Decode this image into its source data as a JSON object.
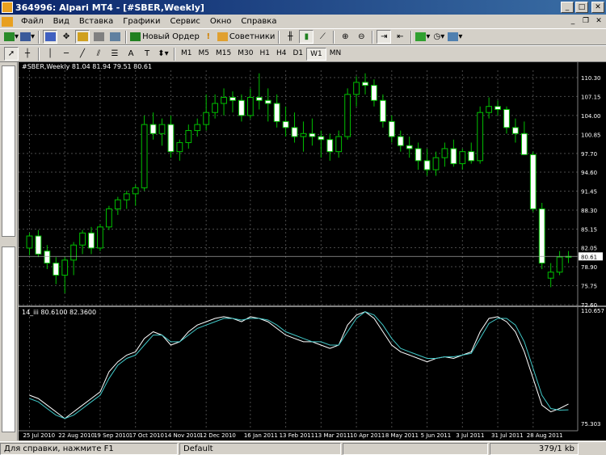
{
  "window": {
    "title": "364996: Alpari MT4 - [#SBER,Weekly]"
  },
  "menu": [
    "Файл",
    "Вид",
    "Вставка",
    "Графики",
    "Сервис",
    "Окно",
    "Справка"
  ],
  "toolbar": {
    "new_order_label": "Новый Ордер",
    "advisors_label": "Советники"
  },
  "timeframes": [
    "M1",
    "M5",
    "M15",
    "M30",
    "H1",
    "H4",
    "D1",
    "W1",
    "MN"
  ],
  "active_timeframe": "W1",
  "chart": {
    "info_label": "#SBER,Weekly  81.04 81.94 79.51 80.61",
    "current_price": "80.61",
    "price_ticks": [
      "110.30",
      "107.15",
      "104.00",
      "100.85",
      "97.70",
      "94.60",
      "91.45",
      "88.30",
      "85.15",
      "82.05",
      "78.90",
      "75.75",
      "72.60"
    ],
    "indicator_label": "14_iii 80.6100 82.3600",
    "indicator_ticks": [
      "110.657",
      "75.303"
    ],
    "date_labels": [
      "25 Jul 2010",
      "22 Aug 2010",
      "19 Sep 2010",
      "17 Oct 2010",
      "14 Nov 2010",
      "12 Dec 2010",
      "16 Jan 2011",
      "13 Feb 2011",
      "13 Mar 2011",
      "10 Apr 2011",
      "8 May 2011",
      "5 Jun 2011",
      "3 Jul 2011",
      "31 Jul 2011",
      "28 Aug 2011"
    ],
    "colors": {
      "bg": "#000000",
      "bull": "#000000",
      "bear": "#ffffff",
      "wick": "#00c000",
      "grid": "#4a4a4a",
      "line1": "#ffffff",
      "line2": "#40c8c8"
    }
  },
  "chart_data": {
    "type": "candlestick",
    "title": "#SBER,Weekly",
    "ylim": [
      72.6,
      111.5
    ],
    "open_high_low_close": [
      [
        82.0,
        84.5,
        80.8,
        84.0
      ],
      [
        84.0,
        85.0,
        80.5,
        81.0
      ],
      [
        81.5,
        82.5,
        78.5,
        79.5
      ],
      [
        79.5,
        80.5,
        76.0,
        77.5
      ],
      [
        77.5,
        80.5,
        74.5,
        80.0
      ],
      [
        80.0,
        83.0,
        77.5,
        82.5
      ],
      [
        82.5,
        85.0,
        81.0,
        84.5
      ],
      [
        84.5,
        85.5,
        81.0,
        82.0
      ],
      [
        82.0,
        86.0,
        81.5,
        85.5
      ],
      [
        85.5,
        89.0,
        85.0,
        88.5
      ],
      [
        88.5,
        90.5,
        87.5,
        90.0
      ],
      [
        90.0,
        91.5,
        88.5,
        91.0
      ],
      [
        91.0,
        92.5,
        89.0,
        92.0
      ],
      [
        92.0,
        104.0,
        91.5,
        102.5
      ],
      [
        102.5,
        104.5,
        100.0,
        101.0
      ],
      [
        101.0,
        103.5,
        99.0,
        102.5
      ],
      [
        102.5,
        104.0,
        97.0,
        98.0
      ],
      [
        98.0,
        100.0,
        96.5,
        99.5
      ],
      [
        99.5,
        102.5,
        98.5,
        101.5
      ],
      [
        101.5,
        103.5,
        100.5,
        102.5
      ],
      [
        102.5,
        107.5,
        101.5,
        104.5
      ],
      [
        104.5,
        107.5,
        103.5,
        106.0
      ],
      [
        106.0,
        108.5,
        104.0,
        107.0
      ],
      [
        107.0,
        108.0,
        104.5,
        106.5
      ],
      [
        106.5,
        107.5,
        103.0,
        104.0
      ],
      [
        104.0,
        108.5,
        103.5,
        107.0
      ],
      [
        107.0,
        111.0,
        105.0,
        106.5
      ],
      [
        106.5,
        108.5,
        103.0,
        106.0
      ],
      [
        106.0,
        107.5,
        102.0,
        103.0
      ],
      [
        103.0,
        105.5,
        100.5,
        102.0
      ],
      [
        102.0,
        104.5,
        99.5,
        100.5
      ],
      [
        100.5,
        103.0,
        98.0,
        101.0
      ],
      [
        101.0,
        103.5,
        99.0,
        100.5
      ],
      [
        100.5,
        101.5,
        97.0,
        100.0
      ],
      [
        100.0,
        101.0,
        96.5,
        98.0
      ],
      [
        98.0,
        101.5,
        97.0,
        100.5
      ],
      [
        100.5,
        108.5,
        100.0,
        107.5
      ],
      [
        107.5,
        110.5,
        105.5,
        109.5
      ],
      [
        109.5,
        111.0,
        107.5,
        109.0
      ],
      [
        109.0,
        110.0,
        105.5,
        106.5
      ],
      [
        106.5,
        107.5,
        102.0,
        103.0
      ],
      [
        103.0,
        104.0,
        99.5,
        100.5
      ],
      [
        100.5,
        101.5,
        98.0,
        99.0
      ],
      [
        99.0,
        100.5,
        97.0,
        98.5
      ],
      [
        98.5,
        99.5,
        95.0,
        96.5
      ],
      [
        96.5,
        98.5,
        94.0,
        95.0
      ],
      [
        95.0,
        98.0,
        94.0,
        97.0
      ],
      [
        97.0,
        99.5,
        95.5,
        98.5
      ],
      [
        98.5,
        100.0,
        95.5,
        96.0
      ],
      [
        96.0,
        98.5,
        95.0,
        98.0
      ],
      [
        98.0,
        99.5,
        96.0,
        96.5
      ],
      [
        96.5,
        105.5,
        96.0,
        104.5
      ],
      [
        104.5,
        107.0,
        103.5,
        105.5
      ],
      [
        105.5,
        106.5,
        104.0,
        105.0
      ],
      [
        105.0,
        105.5,
        101.0,
        102.0
      ],
      [
        102.0,
        103.5,
        99.5,
        101.0
      ],
      [
        101.0,
        103.0,
        97.5,
        97.5
      ],
      [
        97.5,
        98.0,
        88.0,
        88.5
      ],
      [
        88.5,
        89.5,
        78.5,
        79.5
      ],
      [
        77.0,
        79.5,
        75.5,
        78.0
      ],
      [
        78.0,
        81.5,
        77.5,
        80.5
      ],
      [
        80.5,
        81.5,
        79.5,
        80.61
      ]
    ],
    "indicator_series": [
      {
        "values": [
          85,
          84,
          82,
          80,
          78,
          80,
          82,
          84,
          86,
          92,
          95,
          97,
          98,
          102,
          104,
          103,
          100,
          101,
          104,
          106,
          107,
          108,
          108.5,
          108,
          107,
          108.5,
          108,
          107,
          105,
          103,
          102,
          101,
          101,
          100,
          99,
          100,
          106,
          109,
          110,
          108,
          104,
          100,
          98,
          97,
          96,
          95,
          96,
          96.5,
          96,
          97,
          98,
          104,
          108,
          108.5,
          107,
          104,
          98,
          90,
          82,
          80,
          81,
          82.36
        ]
      },
      {
        "values": [
          84,
          83,
          81,
          79,
          78,
          79,
          81,
          83,
          85,
          90,
          94,
          96,
          97,
          100,
          103,
          103,
          101,
          101,
          103,
          105,
          106,
          107,
          108,
          108,
          107.5,
          108,
          108,
          107.5,
          106,
          104,
          103,
          102,
          101,
          101,
          100,
          100,
          104,
          108,
          110,
          109,
          106,
          102,
          99,
          98,
          97,
          96,
          96,
          96.5,
          96.5,
          97,
          97.5,
          102,
          106.5,
          108,
          108,
          106,
          101,
          93,
          85,
          81,
          80.5,
          80.61
        ]
      }
    ],
    "indicator_ylim": [
      75.303,
      110.657
    ]
  }
}
